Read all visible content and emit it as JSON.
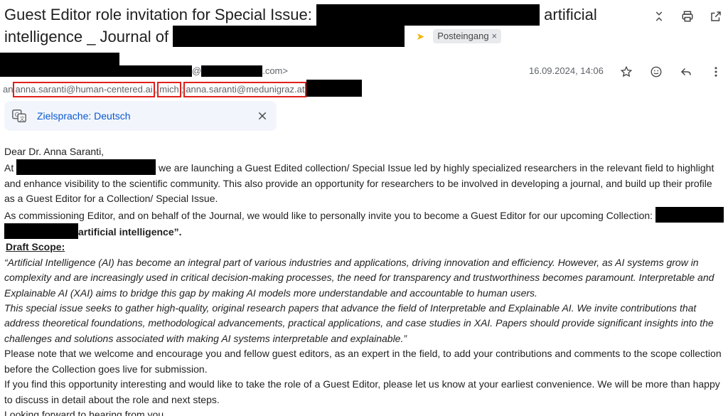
{
  "subject": {
    "part1": "Guest Editor role invitation for Special Issue:",
    "part2": "artificial",
    "part3": "intelligence _ Journal of",
    "label": "Posteingang",
    "label_remove": "×"
  },
  "sender": {
    "email_suffix": ".com>",
    "at": "@",
    "open_bracket": "<",
    "date": "16.09.2024, 14:06"
  },
  "recipients": {
    "prefix": "an",
    "r1": "anna.saranti@human-centered.ai",
    "sep1": ",",
    "r2": "mich",
    "sep2": ";",
    "r3": "anna.saranti@medunigraz.at"
  },
  "translate": {
    "label": "Zielsprache: Deutsch"
  },
  "body": {
    "greeting": "Dear Dr. Anna Saranti,",
    "p1_a": "At",
    "p1_b": "we are launching a Guest Edited collection/ Special Issue led by highly specialized researchers in the relevant field to highlight and enhance visibility to the scientific community. This also provide an opportunity for researchers to be involved in developing a journal, and build up their profile as a Guest Editor for a Collection/ Special Issue.",
    "p2_a": "As commissioning Editor, and on behalf of the Journal, we would like to personally invite you to become a Guest Editor for our upcoming Collection:",
    "p2_b": "artificial intelligence”.",
    "scope_title": "Draft Scope:",
    "scope_p1": "“Artificial Intelligence (AI) has become an integral part of various industries and applications, driving innovation and efficiency. However, as AI systems grow in complexity and are increasingly used in critical decision-making processes, the need for transparency and trustworthiness becomes paramount. Interpretable and Explainable AI (XAI) aims to bridge this gap by making AI models more understandable and accountable to human users.",
    "scope_p2": "This special issue seeks to gather high-quality, original research papers that advance the field of Interpretable and Explainable AI. We invite contributions that address theoretical foundations, methodological advancements, practical applications, and case studies in XAI. Papers should provide significant insights into the challenges and solutions associated with making AI systems interpretable and explainable.”",
    "p3": "Please note that we welcome and encourage you and fellow guest editors, as an expert in the field, to add your contributions and comments to the scope collection before the Collection goes live for submission.",
    "p4": "If you find this opportunity interesting and would like to take the role of a Guest Editor, please let us know at your earliest convenience. We will be more than happy to discuss in detail about the role and next steps.",
    "p5": "Looking forward to hearing from you."
  },
  "icons": {
    "collapse": "collapse-all-icon",
    "print": "print-icon",
    "open_new": "open-in-new-window-icon",
    "star": "star-icon",
    "emoji": "add-reaction-icon",
    "reply": "reply-icon",
    "more": "more-vert-icon",
    "translate": "translate-icon",
    "close": "close-icon",
    "important": "important-marker-icon"
  }
}
